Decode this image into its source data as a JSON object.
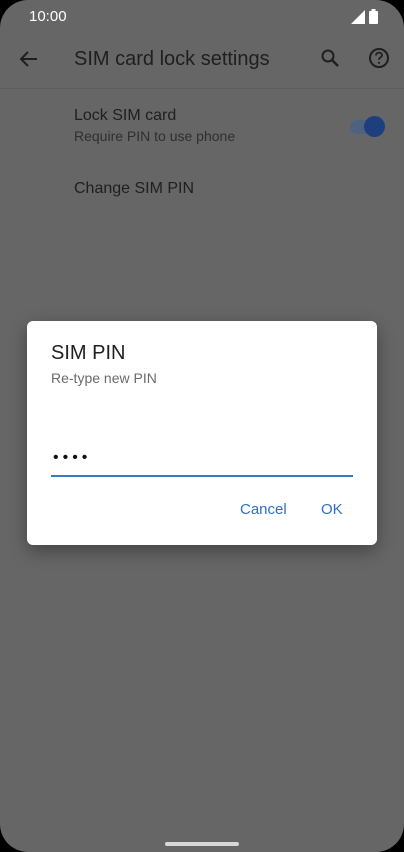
{
  "status_bar": {
    "time": "10:00",
    "icons": [
      "signal-icon",
      "battery-icon"
    ]
  },
  "app_bar": {
    "title": "SIM card lock settings",
    "icons": [
      "back-arrow-icon",
      "search-icon",
      "help-icon"
    ]
  },
  "settings": {
    "lock_sim": {
      "title": "Lock SIM card",
      "summary": "Require PIN to use phone",
      "toggle_on": true
    },
    "change_pin": {
      "title": "Change SIM PIN"
    }
  },
  "dialog": {
    "title": "SIM PIN",
    "message": "Re-type new PIN",
    "pin_value": "••••",
    "cancel_label": "Cancel",
    "ok_label": "OK"
  },
  "colors": {
    "scrim": "#666666",
    "accent": "#2f6fc6",
    "toggle_thumb": "#1e3f7d"
  }
}
